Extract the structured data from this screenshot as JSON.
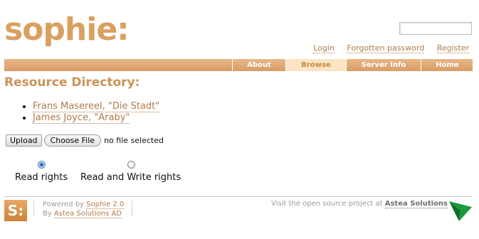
{
  "header": {
    "logo_text": "sophie:",
    "search_value": "",
    "links": {
      "login": "Login",
      "forgotten": "Forgotten password",
      "register": "Register"
    }
  },
  "nav": {
    "tabs": [
      {
        "label": "About",
        "active": false
      },
      {
        "label": "Browse",
        "active": true
      },
      {
        "label": "Server Info",
        "active": false
      },
      {
        "label": "Home",
        "active": false
      }
    ]
  },
  "main": {
    "title": "Resource Directory:",
    "resources": [
      "Frans Masereel, \"Die Stadt\"",
      "James Joyce, \"Araby\""
    ],
    "upload_label": "Upload",
    "choose_file_label": "Choose File",
    "no_file_text": "no file selected",
    "radios": [
      {
        "label": "Read rights",
        "checked": true
      },
      {
        "label": "Read and Write rights",
        "checked": false
      }
    ]
  },
  "footer": {
    "logo_text": "S:",
    "powered_prefix": "Powered by",
    "powered_link": "Sophie 2.0",
    "by_prefix": "By",
    "by_link": "Astea Solutions AD",
    "visit_prefix": "Visit the open source project at",
    "visit_link": "Astea Solutions"
  },
  "colors": {
    "accent": "#d89c66",
    "link": "#b07a4a",
    "title": "#cc9356",
    "arrow": "#1a9a3a"
  }
}
